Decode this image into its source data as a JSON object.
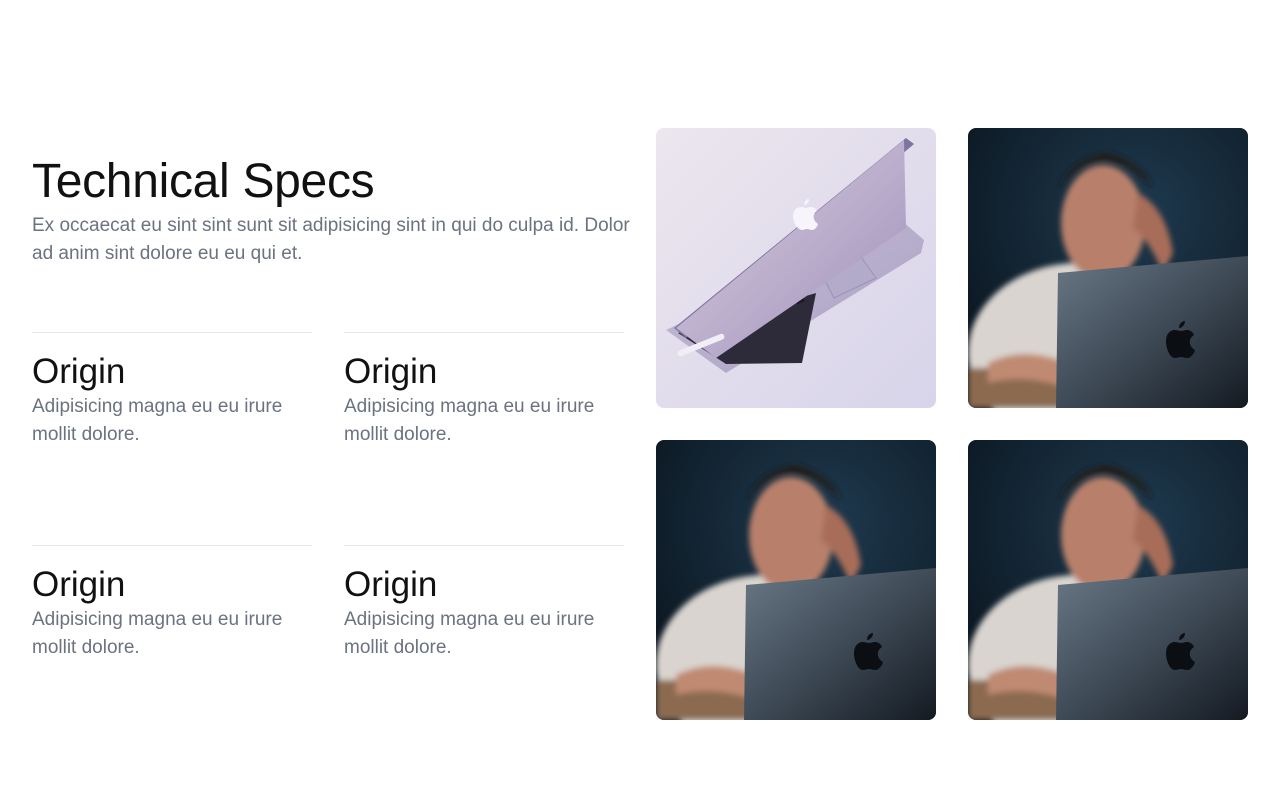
{
  "header": {
    "title": "Technical Specs",
    "description": "Ex occaecat eu sint sint sunt sit adipisicing sint in qui do culpa id. Dolor ad anim sint dolore eu eu qui et."
  },
  "specs": [
    {
      "title": "Origin",
      "description": "Adipisicing magna eu eu irure mollit dolore."
    },
    {
      "title": "Origin",
      "description": "Adipisicing magna eu eu irure mollit dolore."
    },
    {
      "title": "Origin",
      "description": "Adipisicing magna eu eu irure mollit dolore."
    },
    {
      "title": "Origin",
      "description": "Adipisicing magna eu eu irure mollit dolore."
    }
  ],
  "gallery": [
    {
      "subject": "laptop-photo"
    },
    {
      "subject": "person-with-laptop-photo"
    },
    {
      "subject": "person-with-laptop-photo"
    },
    {
      "subject": "person-with-laptop-photo"
    }
  ],
  "colors": {
    "heading": "#111111",
    "muted_text": "#6b7280",
    "divider": "#e5e7eb"
  }
}
